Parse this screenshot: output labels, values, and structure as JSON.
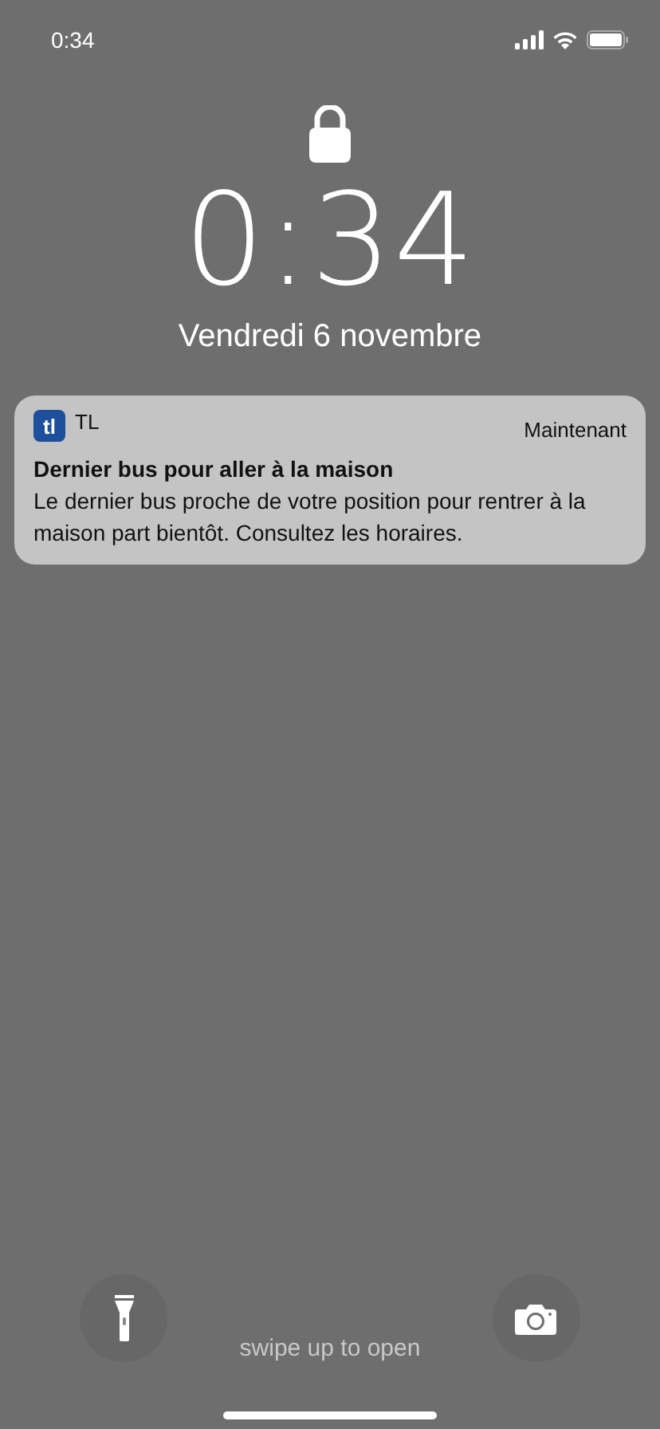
{
  "status_bar": {
    "time": "0:34"
  },
  "lock_screen": {
    "time": "0:34",
    "date": "Vendredi 6 novembre"
  },
  "notification": {
    "app_icon_text": "tl",
    "app_name": "TL",
    "time": "Maintenant",
    "title": "Dernier bus pour aller à la maison",
    "body": "Le dernier bus proche de votre position pour rentrer à la maison part bientôt. Consultez les horaires."
  },
  "bottom": {
    "hint": "swipe up to open"
  }
}
